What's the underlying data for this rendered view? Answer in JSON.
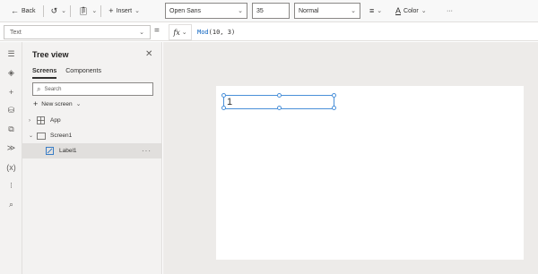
{
  "toolbar": {
    "back_label": "Back",
    "insert_label": "Insert",
    "font_value": "Open Sans",
    "font_size_value": "35",
    "font_weight_value": "Normal",
    "color_label": "Color",
    "more_label": "···"
  },
  "formula_bar": {
    "property": "Text",
    "equals": "=",
    "fx_label": "fx",
    "formula_fn": "Mod",
    "formula_args": "(10, 3)"
  },
  "tree_view": {
    "title": "Tree view",
    "tabs": [
      "Screens",
      "Components"
    ],
    "active_tab": "Screens",
    "search_placeholder": "Search",
    "new_screen_label": "New screen",
    "nodes": [
      {
        "label": "App",
        "icon": "app-icon"
      },
      {
        "label": "Screen1",
        "icon": "screen-icon"
      },
      {
        "label": "Label1",
        "icon": "label-icon",
        "selected": true
      }
    ],
    "more_label": "···"
  },
  "canvas": {
    "label_text": "1"
  },
  "colors": {
    "accent": "#4a90d9",
    "formula_function": "#0e64c1",
    "canvas_bg": "#edebe9",
    "panel_bg": "#f3f2f1"
  }
}
